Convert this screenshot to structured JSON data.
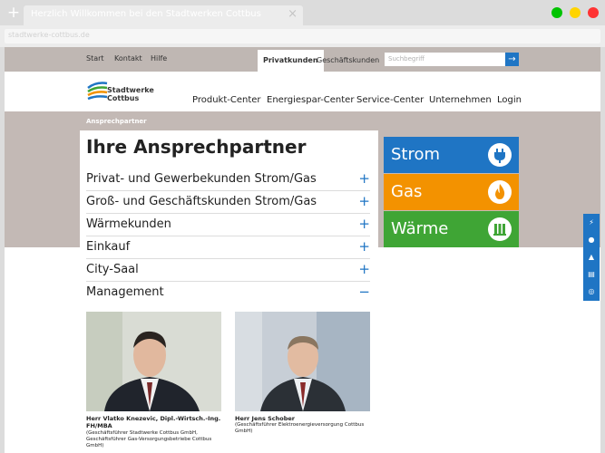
{
  "browser": {
    "tab_title": "Herzlich Willkommen bei den Stadtwerken Cottbus",
    "new_tab_symbol": "+",
    "close_symbol": "×",
    "url": "stadtwerke-cottbus.de",
    "window_dot_colors": [
      "#00c300",
      "#ffd400",
      "#ff3333"
    ]
  },
  "topnav": {
    "links": [
      "Start",
      "Kontakt",
      "Hilfe"
    ],
    "segments": [
      "Privatkunden",
      "Geschäftskunden"
    ],
    "active_segment": "Privatkunden",
    "search_placeholder": "Suchbegriff",
    "search_button_symbol": "→"
  },
  "logo": {
    "line1": "Stadtwerke",
    "line2": "Cottbus"
  },
  "main_nav": [
    "Produkt-Center",
    "Energiespar-Center",
    "Service-Center",
    "Unternehmen",
    "Login"
  ],
  "breadcrumb": "Ansprechpartner",
  "page_title": "Ihre Ansprechpartner",
  "accordion": [
    {
      "label": "Privat- und Gewerbekunden Strom/Gas",
      "icon": "+"
    },
    {
      "label": "Groß- und Geschäftskunden Strom/Gas",
      "icon": "+"
    },
    {
      "label": "Wärmekunden",
      "icon": "+"
    },
    {
      "label": "Einkauf",
      "icon": "+"
    },
    {
      "label": "City-Saal",
      "icon": "+"
    },
    {
      "label": "Management",
      "icon": "−"
    }
  ],
  "contacts": [
    {
      "name": "Herr Vlatko Knezevic, Dipl.-Wirtsch.-Ing. FH/MBA",
      "role": "(Geschäftsführer Stadtwerke Cottbus GmbH, Geschäftsführer Gas-Versorgungsbetriebe Cottbus GmbH)"
    },
    {
      "name": "Herr Jens Schober",
      "role": "(Geschäftsführer Elektroenergieversorgung Cottbus GmbH)"
    }
  ],
  "energy": [
    {
      "label": "Strom",
      "color": "#1f75c4",
      "icon": "plug-icon"
    },
    {
      "label": "Gas",
      "color": "#f39200",
      "icon": "flame-icon"
    },
    {
      "label": "Wärme",
      "color": "#3fa535",
      "icon": "radiator-icon"
    }
  ],
  "side_tools": [
    {
      "icon": "lightning-icon",
      "glyph": "⚡"
    },
    {
      "icon": "person-icon",
      "glyph": "●"
    },
    {
      "icon": "pyramid-icon",
      "glyph": "▲"
    },
    {
      "icon": "document-icon",
      "glyph": "▤"
    },
    {
      "icon": "lifebuoy-icon",
      "glyph": "◎"
    }
  ]
}
